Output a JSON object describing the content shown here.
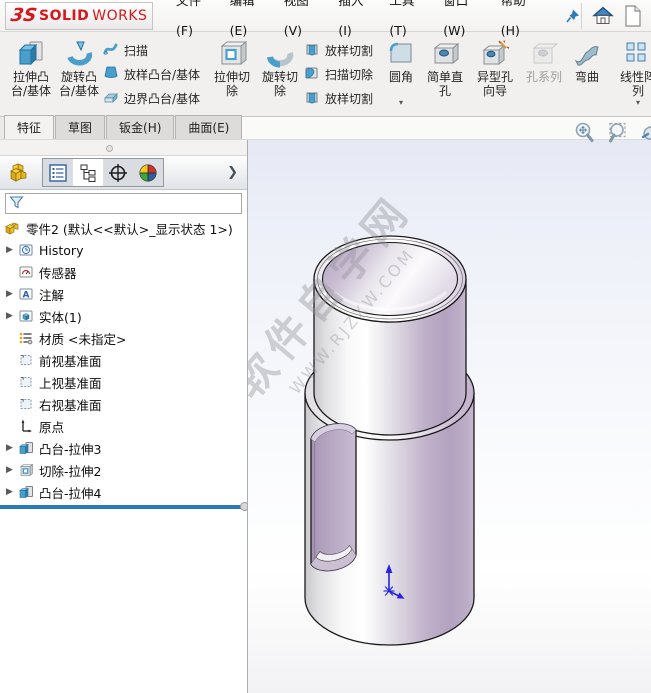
{
  "menubar": {
    "brand": {
      "mark": "3S",
      "solid": "SOLID",
      "works": "WORKS"
    },
    "menus": [
      {
        "label": "文件(F)"
      },
      {
        "label": "编辑(E)"
      },
      {
        "label": "视图(V)"
      },
      {
        "label": "插入(I)"
      },
      {
        "label": "工具(T)"
      },
      {
        "label": "窗口(W)"
      },
      {
        "label": "帮助(H)"
      }
    ]
  },
  "ribbon": {
    "groups": [
      {
        "big": [
          {
            "lines": [
              "拉伸凸",
              "台/基体"
            ]
          },
          {
            "lines": [
              "旋转凸",
              "台/基体"
            ]
          }
        ],
        "small": [
          {
            "label": "扫描"
          },
          {
            "label": "放样凸台/基体"
          },
          {
            "label": "边界凸台/基体"
          }
        ]
      },
      {
        "big": [
          {
            "lines": [
              "拉伸切",
              "除"
            ]
          },
          {
            "lines": [
              "旋转切",
              "除"
            ]
          }
        ],
        "small": [
          {
            "label": "放样切割"
          },
          {
            "label": "扫描切除"
          },
          {
            "label": "放样切割"
          }
        ]
      },
      {
        "big": [
          {
            "lines": [
              "圆角",
              ""
            ],
            "dropdown": "▾"
          },
          {
            "lines": [
              "简单直",
              "孔"
            ]
          },
          {
            "lines": [
              "异型孔",
              "向导"
            ]
          },
          {
            "lines": [
              "孔系列",
              ""
            ],
            "disabled": true
          },
          {
            "lines": [
              "弯曲",
              ""
            ]
          }
        ]
      },
      {
        "big": [
          {
            "lines": [
              "线性阵",
              "列"
            ],
            "dropdown": "▾"
          }
        ]
      }
    ]
  },
  "tabs": [
    {
      "label": "特征",
      "active": true
    },
    {
      "label": "草图"
    },
    {
      "label": "钣金(H)"
    },
    {
      "label": "曲面(E)"
    }
  ],
  "panel": {
    "filter_value": "",
    "tree": {
      "root": "零件2 (默认<<默认>_显示状态 1>)",
      "items": [
        {
          "label": "History",
          "expandable": true
        },
        {
          "label": "传感器"
        },
        {
          "label": "注解",
          "expandable": true
        },
        {
          "label": "实体(1)",
          "expandable": true
        },
        {
          "label": "材质 <未指定>"
        },
        {
          "label": "前视基准面"
        },
        {
          "label": "上视基准面"
        },
        {
          "label": "右视基准面"
        },
        {
          "label": "原点"
        },
        {
          "label": "凸台-拉伸3",
          "expandable": true
        },
        {
          "label": "切除-拉伸2",
          "expandable": true
        },
        {
          "label": "凸台-拉伸4",
          "expandable": true
        }
      ]
    }
  },
  "viewport": {
    "watermark": {
      "line1": "软件自学网",
      "line2": "WWW.RJZXW.COM"
    },
    "headsup_icons": [
      "zoom-fit-icon",
      "zoom-area-icon",
      "magnifier-partial-icon"
    ],
    "colors": {
      "model_lavender": "#b4a3c1",
      "model_highlight": "#ffffff",
      "origin_blue": "#2525df",
      "rollback_blue": "#2b7ab8",
      "logo_red": "#d6171c",
      "background_top": "#e6e9f4"
    }
  }
}
